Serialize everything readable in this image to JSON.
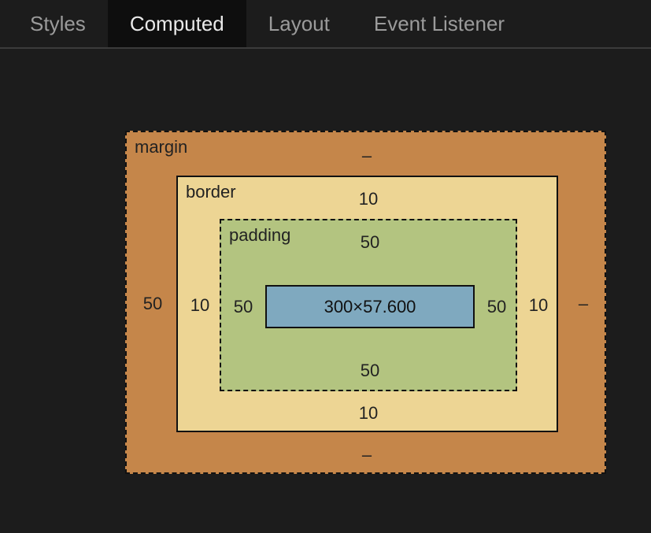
{
  "tabs": {
    "styles": "Styles",
    "computed": "Computed",
    "layout": "Layout",
    "event_listeners": "Event Listener"
  },
  "active_tab": "computed",
  "boxmodel": {
    "margin": {
      "label": "margin",
      "top": "–",
      "right": "–",
      "bottom": "–",
      "left": "50"
    },
    "border": {
      "label": "border",
      "top": "10",
      "right": "10",
      "bottom": "10",
      "left": "10"
    },
    "padding": {
      "label": "padding",
      "top": "50",
      "right": "50",
      "bottom": "50",
      "left": "50"
    },
    "content": {
      "width": "300",
      "height": "57.600",
      "display": "300×57.600"
    }
  }
}
